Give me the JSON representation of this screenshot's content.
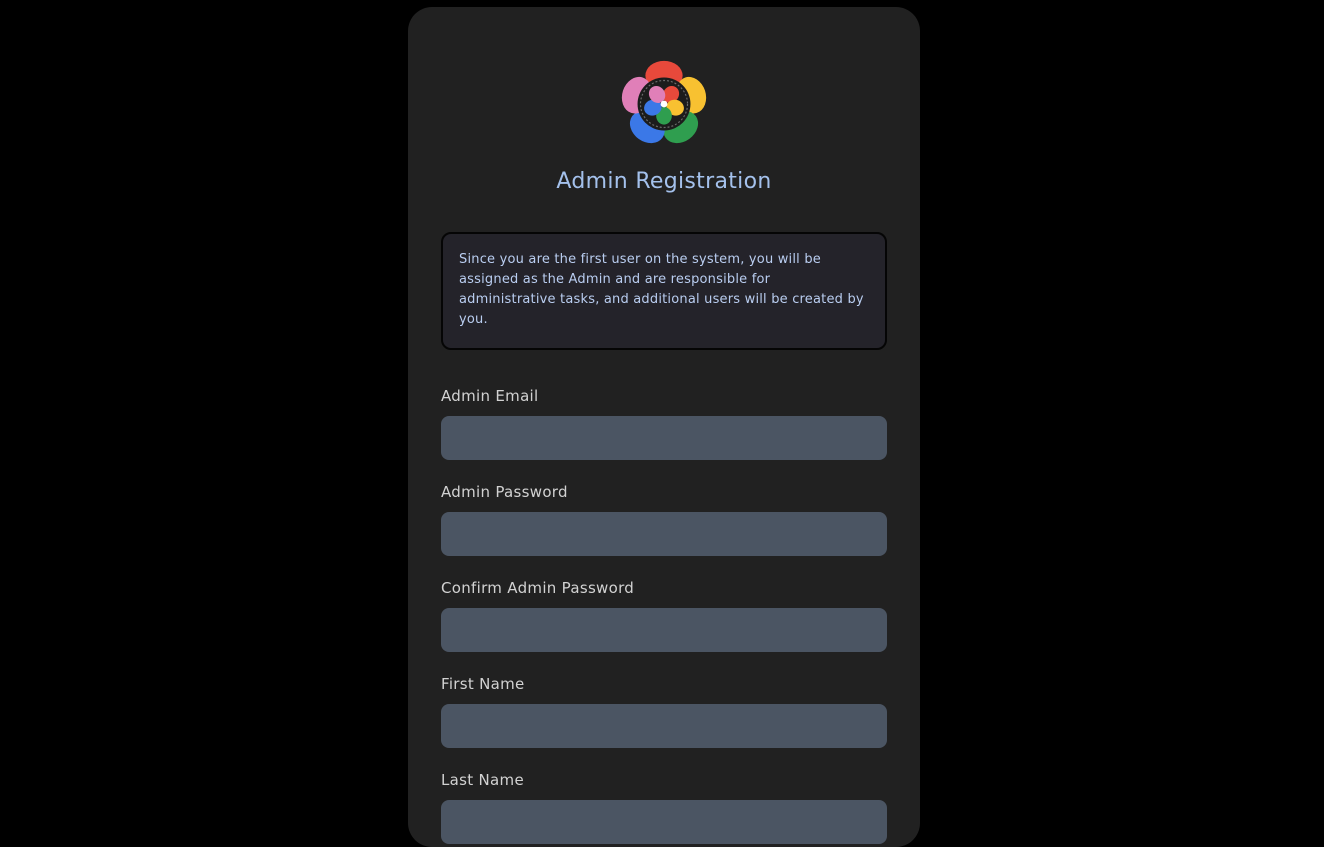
{
  "logo": {
    "icon": "flower-logo-icon"
  },
  "title": "Admin Registration",
  "notice": "Since you are the first user on the system, you will be assigned as the Admin and are responsible for administrative tasks, and additional users will be created by you.",
  "fields": [
    {
      "label": "Admin Email",
      "value": ""
    },
    {
      "label": "Admin Password",
      "value": ""
    },
    {
      "label": "Confirm Admin Password",
      "value": ""
    },
    {
      "label": "First Name",
      "value": ""
    },
    {
      "label": "Last Name",
      "value": ""
    }
  ],
  "colors": {
    "background": "#000000",
    "card": "#212121",
    "title": "#a4c1ec",
    "input": "#4b5563"
  }
}
